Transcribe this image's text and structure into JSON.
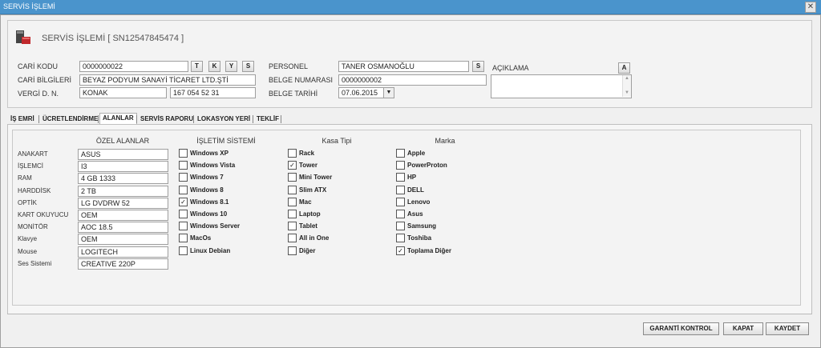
{
  "window": {
    "title": "SERVİS İŞLEMİ",
    "close_glyph": "✕"
  },
  "header": {
    "title": "SERVİS İŞLEMİ [ SN12547845474 ]",
    "icon": "service-box-icon"
  },
  "form": {
    "cari_kodu": {
      "label": "CARİ KODU",
      "value": "0000000022",
      "buttons": [
        "T",
        "K",
        "Y",
        "S"
      ]
    },
    "cari_bilgileri": {
      "label": "CARİ BİLGİLERİ",
      "value": "BEYAZ PODYUM SANAYİ TİCARET LTD.ŞTİ"
    },
    "vergi": {
      "label": "VERGİ D. N.",
      "office": "KONAK",
      "number": "167 054 52 31"
    },
    "personel": {
      "label": "PERSONEL",
      "value": "TANER OSMANOĞLU",
      "button": "S"
    },
    "belge_no": {
      "label": "BELGE NUMARASI",
      "value": "0000000002"
    },
    "belge_tarihi": {
      "label": "BELGE TARİHİ",
      "value": "07.06.2015"
    },
    "aciklama": {
      "label": "AÇIKLAMA",
      "button": "A",
      "value": ""
    }
  },
  "tabs": [
    "İŞ EMRİ",
    "ÜCRETLENDİRME",
    "ALANLAR",
    "SERVİS RAPORU",
    "LOKASYON YERİ",
    "TEKLİF"
  ],
  "active_tab": "ALANLAR",
  "ozel_alanlar": {
    "heading": "ÖZEL ALANLAR",
    "rows": [
      {
        "label": "ANAKART",
        "value": "ASUS"
      },
      {
        "label": "İŞLEMCİ",
        "value": "I3"
      },
      {
        "label": "RAM",
        "value": "4 GB 1333"
      },
      {
        "label": "HARDDİSK",
        "value": "2 TB"
      },
      {
        "label": "OPTİK",
        "value": "LG DVDRW 52"
      },
      {
        "label": "KART OKUYUCU",
        "value": "OEM"
      },
      {
        "label": "MONİTÖR",
        "value": "AOC 18.5"
      },
      {
        "label": "Klavye",
        "value": "OEM"
      },
      {
        "label": "Mouse",
        "value": "LOGITECH"
      },
      {
        "label": "Ses Sistemi",
        "value": "CREATIVE 220P"
      }
    ]
  },
  "isletim": {
    "heading": "İŞLETİM SİSTEMİ",
    "options": [
      {
        "label": "Windows XP",
        "checked": false
      },
      {
        "label": "Windows Vista",
        "checked": false
      },
      {
        "label": "Windows 7",
        "checked": false
      },
      {
        "label": "Windows 8",
        "checked": false
      },
      {
        "label": "Windows 8.1",
        "checked": true
      },
      {
        "label": "Windows 10",
        "checked": false
      },
      {
        "label": "Windows Server",
        "checked": false
      },
      {
        "label": "MacOs",
        "checked": false
      },
      {
        "label": "Linux Debian",
        "checked": false
      }
    ]
  },
  "kasa": {
    "heading": "Kasa Tipi",
    "options": [
      {
        "label": "Rack",
        "checked": false
      },
      {
        "label": "Tower",
        "checked": true
      },
      {
        "label": "Mini Tower",
        "checked": false
      },
      {
        "label": "Slim ATX",
        "checked": false
      },
      {
        "label": "Mac",
        "checked": false
      },
      {
        "label": "Laptop",
        "checked": false
      },
      {
        "label": "Tablet",
        "checked": false
      },
      {
        "label": "All in One",
        "checked": false
      },
      {
        "label": "Diğer",
        "checked": false
      }
    ]
  },
  "marka": {
    "heading": "Marka",
    "options": [
      {
        "label": "Apple",
        "checked": false
      },
      {
        "label": "PowerProton",
        "checked": false
      },
      {
        "label": "HP",
        "checked": false
      },
      {
        "label": "DELL",
        "checked": false
      },
      {
        "label": "Lenovo",
        "checked": false
      },
      {
        "label": "Asus",
        "checked": false
      },
      {
        "label": "Samsung",
        "checked": false
      },
      {
        "label": "Toshiba",
        "checked": false
      },
      {
        "label": "Toplama Diğer",
        "checked": true
      }
    ]
  },
  "buttons": {
    "garanti": "GARANTİ KONTROL",
    "kapat": "KAPAT",
    "kaydet": "KAYDET"
  },
  "colors": {
    "titlebar": "#4a94cc",
    "window_bg": "#f0f0f0"
  }
}
